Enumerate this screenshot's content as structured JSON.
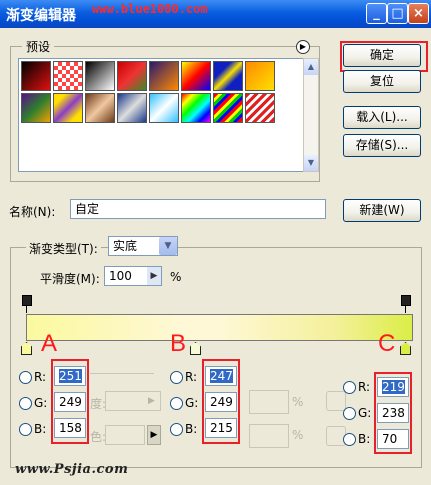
{
  "window": {
    "title": "渐变编辑器",
    "watermark_url": "www.blue1000.com"
  },
  "presets": {
    "label": "预设",
    "menu_icon": "triangle-right-icon"
  },
  "buttons": {
    "ok": "确定",
    "reset": "复位",
    "load": "载入(L)...",
    "save": "存储(S)...",
    "new": "新建(W)"
  },
  "name": {
    "label": "名称(N):",
    "value": "自定"
  },
  "gradient": {
    "type_label": "渐变类型(T):",
    "type_value": "实底",
    "smooth_label": "平滑度(M):",
    "smooth_value": "100",
    "smooth_unit": "%"
  },
  "markers": {
    "a": "A",
    "b": "B",
    "c": "C"
  },
  "stops": [
    {
      "r": "251",
      "g": "249",
      "b": "158"
    },
    {
      "r": "247",
      "g": "249",
      "b": "215"
    },
    {
      "r": "219",
      "g": "238",
      "b": "70"
    }
  ],
  "channel_labels": {
    "r": "R:",
    "g": "G:",
    "b": "B:"
  },
  "percent": "%",
  "faded": {
    "opacity_tail": "度:",
    "color_tail": "色:"
  },
  "footer": {
    "watermark": "www.Psjia.com"
  },
  "colors": {
    "accent_red": "#e8202a",
    "title_blue": "#0a5ee0"
  }
}
